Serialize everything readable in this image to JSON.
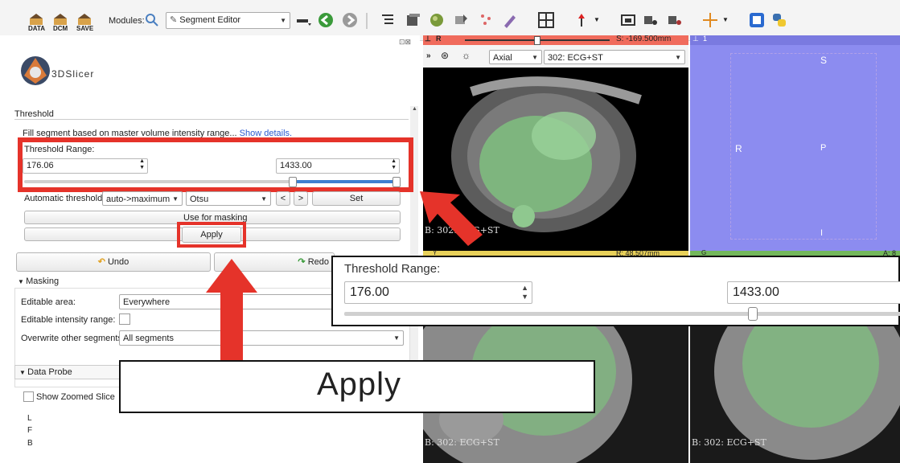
{
  "toolbar": {
    "data_label": "DATA",
    "dcm_label": "DCM",
    "save_label": "SAVE",
    "modules_label": "Modules:",
    "module_selected": "Segment Editor"
  },
  "panel": {
    "logo_text": "3DSlicer",
    "section_title": "Threshold",
    "description": "Fill segment based on master volume intensity range...",
    "show_details": "Show details.",
    "threshold_label": "Threshold Range:",
    "min_value": "176.06",
    "max_value": "1433.00",
    "auto_label": "Automatic threshold:",
    "auto_mode": "auto->maximum",
    "auto_method": "Otsu",
    "prev_label": "<",
    "next_label": ">",
    "set_label": "Set",
    "use_masking": "Use for masking",
    "apply_label": "Apply",
    "undo_label": "Undo",
    "redo_label": "Redo",
    "masking_header": "Masking",
    "editable_area_label": "Editable area:",
    "editable_area_value": "Everywhere",
    "editable_intensity_label": "Editable intensity range:",
    "overwrite_label": "Overwrite other segments:",
    "overwrite_value": "All segments",
    "data_probe_header": "Data Probe",
    "show_zoomed": "Show Zoomed Slice",
    "probe_l": "L",
    "probe_f": "F",
    "probe_b": "B"
  },
  "red_view": {
    "label": "R",
    "offset": "S: -169.500mm",
    "orientation": "Axial",
    "volume": "302: ECG+ST",
    "corner_text": "B: 302: ECG+ST"
  },
  "view3d": {
    "label": "1",
    "axis_s": "S",
    "axis_r": "R",
    "axis_p": "P",
    "axis_i": "I"
  },
  "yellow_view": {
    "label": "Y",
    "offset": "R: 48.507mm",
    "corner_text": "B: 302: ECG+ST"
  },
  "green_view": {
    "label": "G",
    "offset": "A: 8",
    "corner_text": "B: 302: ECG+ST"
  },
  "zoom_threshold": {
    "label": "Threshold Range:",
    "min_value": "176.00",
    "max_value": "1433.00"
  },
  "zoom_apply": {
    "label": "Apply"
  },
  "colors": {
    "annotation_red": "#e5332a",
    "red_bar": "#f06b5c",
    "yellow_bar": "#e8d15a",
    "green_bar": "#73b85a",
    "view3d_bg": "#8c8cf0",
    "segment_green": "#7fbf7f"
  },
  "icons": [
    "data-icon",
    "dcm-icon",
    "save-icon",
    "module-search-icon",
    "back-icon",
    "forward-icon",
    "python-icon"
  ]
}
